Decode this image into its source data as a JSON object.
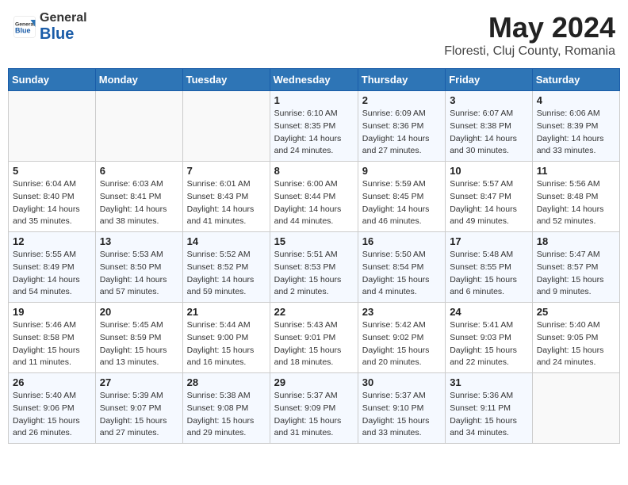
{
  "header": {
    "logo_general": "General",
    "logo_blue": "Blue",
    "title": "May 2024",
    "subtitle": "Floresti, Cluj County, Romania"
  },
  "weekdays": [
    "Sunday",
    "Monday",
    "Tuesday",
    "Wednesday",
    "Thursday",
    "Friday",
    "Saturday"
  ],
  "weeks": [
    [
      {
        "day": "",
        "info": ""
      },
      {
        "day": "",
        "info": ""
      },
      {
        "day": "",
        "info": ""
      },
      {
        "day": "1",
        "info": "Sunrise: 6:10 AM\nSunset: 8:35 PM\nDaylight: 14 hours\nand 24 minutes."
      },
      {
        "day": "2",
        "info": "Sunrise: 6:09 AM\nSunset: 8:36 PM\nDaylight: 14 hours\nand 27 minutes."
      },
      {
        "day": "3",
        "info": "Sunrise: 6:07 AM\nSunset: 8:38 PM\nDaylight: 14 hours\nand 30 minutes."
      },
      {
        "day": "4",
        "info": "Sunrise: 6:06 AM\nSunset: 8:39 PM\nDaylight: 14 hours\nand 33 minutes."
      }
    ],
    [
      {
        "day": "5",
        "info": "Sunrise: 6:04 AM\nSunset: 8:40 PM\nDaylight: 14 hours\nand 35 minutes."
      },
      {
        "day": "6",
        "info": "Sunrise: 6:03 AM\nSunset: 8:41 PM\nDaylight: 14 hours\nand 38 minutes."
      },
      {
        "day": "7",
        "info": "Sunrise: 6:01 AM\nSunset: 8:43 PM\nDaylight: 14 hours\nand 41 minutes."
      },
      {
        "day": "8",
        "info": "Sunrise: 6:00 AM\nSunset: 8:44 PM\nDaylight: 14 hours\nand 44 minutes."
      },
      {
        "day": "9",
        "info": "Sunrise: 5:59 AM\nSunset: 8:45 PM\nDaylight: 14 hours\nand 46 minutes."
      },
      {
        "day": "10",
        "info": "Sunrise: 5:57 AM\nSunset: 8:47 PM\nDaylight: 14 hours\nand 49 minutes."
      },
      {
        "day": "11",
        "info": "Sunrise: 5:56 AM\nSunset: 8:48 PM\nDaylight: 14 hours\nand 52 minutes."
      }
    ],
    [
      {
        "day": "12",
        "info": "Sunrise: 5:55 AM\nSunset: 8:49 PM\nDaylight: 14 hours\nand 54 minutes."
      },
      {
        "day": "13",
        "info": "Sunrise: 5:53 AM\nSunset: 8:50 PM\nDaylight: 14 hours\nand 57 minutes."
      },
      {
        "day": "14",
        "info": "Sunrise: 5:52 AM\nSunset: 8:52 PM\nDaylight: 14 hours\nand 59 minutes."
      },
      {
        "day": "15",
        "info": "Sunrise: 5:51 AM\nSunset: 8:53 PM\nDaylight: 15 hours\nand 2 minutes."
      },
      {
        "day": "16",
        "info": "Sunrise: 5:50 AM\nSunset: 8:54 PM\nDaylight: 15 hours\nand 4 minutes."
      },
      {
        "day": "17",
        "info": "Sunrise: 5:48 AM\nSunset: 8:55 PM\nDaylight: 15 hours\nand 6 minutes."
      },
      {
        "day": "18",
        "info": "Sunrise: 5:47 AM\nSunset: 8:57 PM\nDaylight: 15 hours\nand 9 minutes."
      }
    ],
    [
      {
        "day": "19",
        "info": "Sunrise: 5:46 AM\nSunset: 8:58 PM\nDaylight: 15 hours\nand 11 minutes."
      },
      {
        "day": "20",
        "info": "Sunrise: 5:45 AM\nSunset: 8:59 PM\nDaylight: 15 hours\nand 13 minutes."
      },
      {
        "day": "21",
        "info": "Sunrise: 5:44 AM\nSunset: 9:00 PM\nDaylight: 15 hours\nand 16 minutes."
      },
      {
        "day": "22",
        "info": "Sunrise: 5:43 AM\nSunset: 9:01 PM\nDaylight: 15 hours\nand 18 minutes."
      },
      {
        "day": "23",
        "info": "Sunrise: 5:42 AM\nSunset: 9:02 PM\nDaylight: 15 hours\nand 20 minutes."
      },
      {
        "day": "24",
        "info": "Sunrise: 5:41 AM\nSunset: 9:03 PM\nDaylight: 15 hours\nand 22 minutes."
      },
      {
        "day": "25",
        "info": "Sunrise: 5:40 AM\nSunset: 9:05 PM\nDaylight: 15 hours\nand 24 minutes."
      }
    ],
    [
      {
        "day": "26",
        "info": "Sunrise: 5:40 AM\nSunset: 9:06 PM\nDaylight: 15 hours\nand 26 minutes."
      },
      {
        "day": "27",
        "info": "Sunrise: 5:39 AM\nSunset: 9:07 PM\nDaylight: 15 hours\nand 27 minutes."
      },
      {
        "day": "28",
        "info": "Sunrise: 5:38 AM\nSunset: 9:08 PM\nDaylight: 15 hours\nand 29 minutes."
      },
      {
        "day": "29",
        "info": "Sunrise: 5:37 AM\nSunset: 9:09 PM\nDaylight: 15 hours\nand 31 minutes."
      },
      {
        "day": "30",
        "info": "Sunrise: 5:37 AM\nSunset: 9:10 PM\nDaylight: 15 hours\nand 33 minutes."
      },
      {
        "day": "31",
        "info": "Sunrise: 5:36 AM\nSunset: 9:11 PM\nDaylight: 15 hours\nand 34 minutes."
      },
      {
        "day": "",
        "info": ""
      }
    ]
  ]
}
